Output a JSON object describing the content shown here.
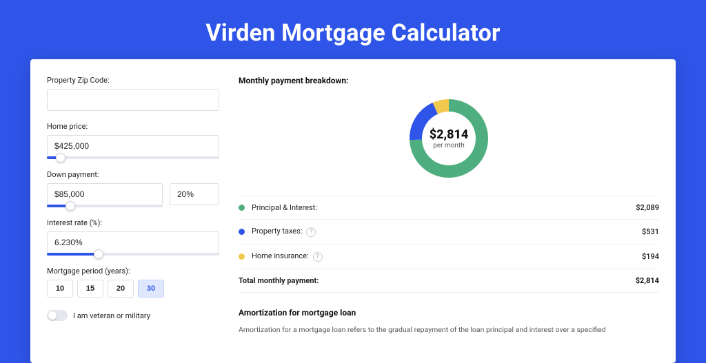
{
  "header": {
    "title": "Virden Mortgage Calculator"
  },
  "form": {
    "zip": {
      "label": "Property Zip Code:",
      "value": ""
    },
    "price": {
      "label": "Home price:",
      "value": "$425,000",
      "slider_pct": 8
    },
    "down": {
      "label": "Down payment:",
      "value": "$85,000",
      "pct": "20%",
      "slider_pct": 20
    },
    "rate": {
      "label": "Interest rate (%):",
      "value": "6.230%",
      "slider_pct": 30
    },
    "period": {
      "label": "Mortgage period (years):",
      "options": [
        "10",
        "15",
        "20",
        "30"
      ],
      "selected": "30"
    },
    "veteran": {
      "label": "I am veteran or military",
      "checked": false
    }
  },
  "breakdown": {
    "title": "Monthly payment breakdown:",
    "donut": {
      "value": "$2,814",
      "sub": "per month"
    },
    "rows": [
      {
        "name": "Principal & Interest:",
        "value": "$2,089",
        "color": "#4fae7f",
        "help": false
      },
      {
        "name": "Property taxes:",
        "value": "$531",
        "color": "#2f55e8",
        "help": true
      },
      {
        "name": "Home insurance:",
        "value": "$194",
        "color": "#f1c94e",
        "help": true
      }
    ],
    "total": {
      "name": "Total monthly payment:",
      "value": "$2,814"
    }
  },
  "amort": {
    "title": "Amortization for mortgage loan",
    "body": "Amortization for a mortgage loan refers to the gradual repayment of the loan principal and interest over a specified"
  },
  "chart_data": {
    "type": "pie",
    "title": "Monthly payment breakdown",
    "series": [
      {
        "name": "Principal & Interest",
        "value": 2089,
        "color": "#4fae7f"
      },
      {
        "name": "Property taxes",
        "value": 531,
        "color": "#2f55e8"
      },
      {
        "name": "Home insurance",
        "value": 194,
        "color": "#f1c94e"
      }
    ],
    "total": 2814,
    "center_label": "$2,814 per month"
  }
}
